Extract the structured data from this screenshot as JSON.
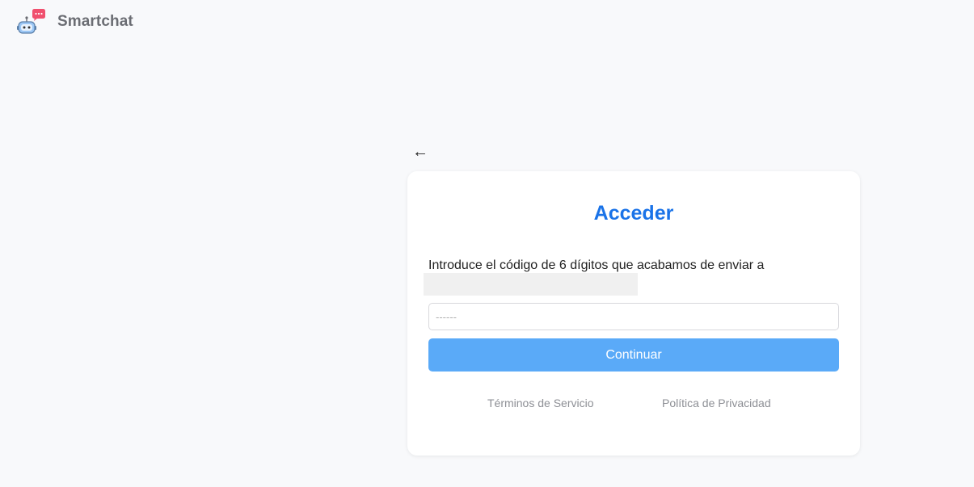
{
  "header": {
    "app_name": "Smartchat",
    "logo_icon": "robot-chat-bubble-icon"
  },
  "back": {
    "label": "←"
  },
  "login": {
    "title": "Acceder",
    "instruction": "Introduce el código de 6 dígitos que acabamos de enviar a",
    "code_placeholder": "------",
    "code_value": "",
    "continue_label": "Continuar"
  },
  "footer": {
    "terms_label": "Términos de Servicio",
    "privacy_label": "Política de Privacidad"
  },
  "colors": {
    "accent": "#1a73e8",
    "button": "#5aaaf8",
    "background": "#f8f9fb"
  }
}
